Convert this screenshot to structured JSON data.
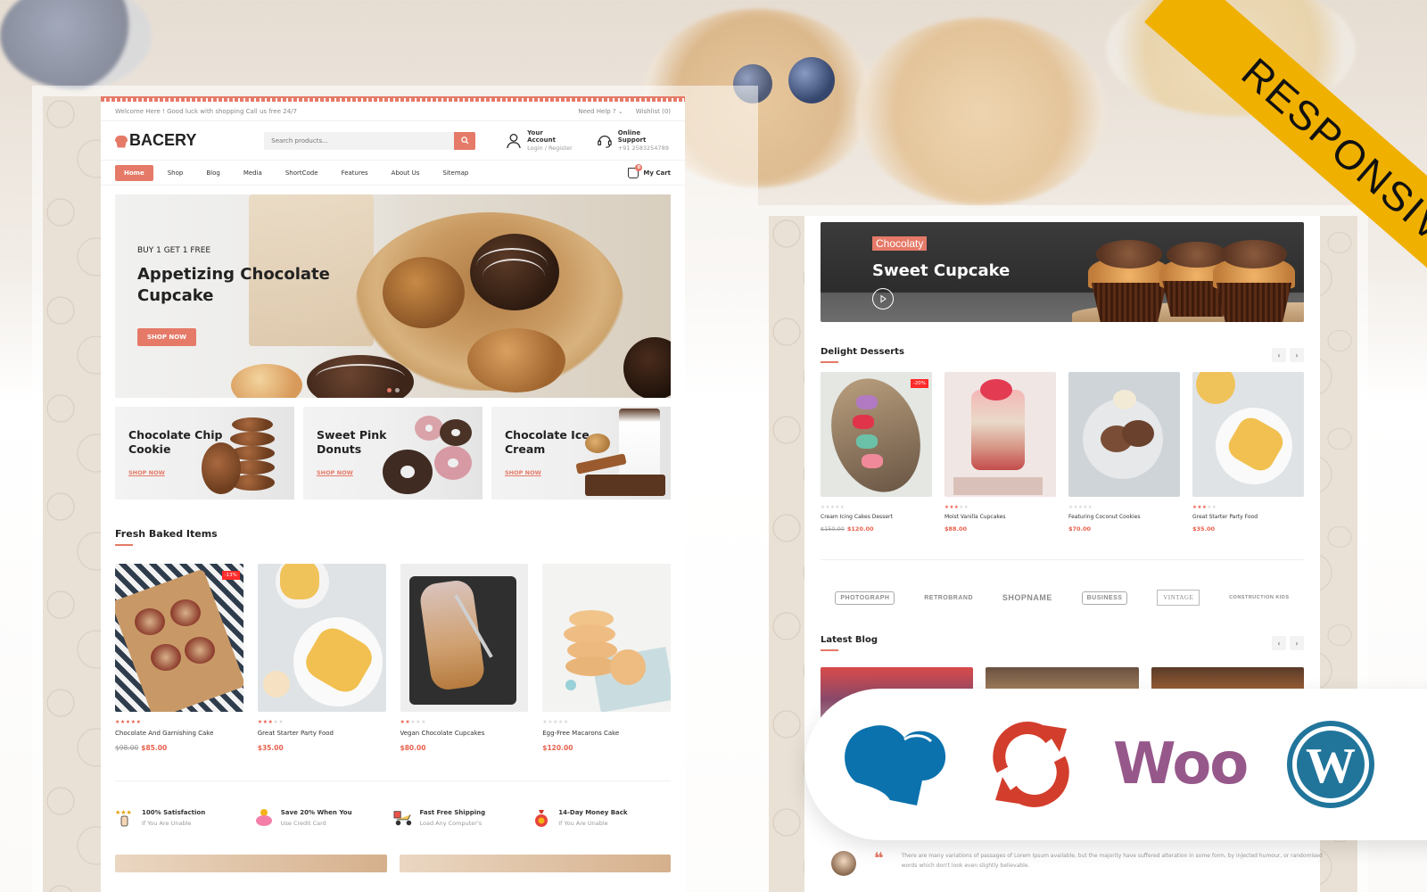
{
  "ribbon": {
    "label": "RESPONSIVE",
    "color": "#f0b000"
  },
  "colors": {
    "accent": "#e57a68",
    "sale": "#ff2a2a",
    "woo": "#96588a",
    "wordpress": "#21759b",
    "chef": "#0b72ad",
    "sync": "#d33e2c"
  },
  "desktop": {
    "topbar": {
      "welcome": "Welcome Here ! Good luck with shopping Call us free 24/7",
      "help": "Need Help ? ⌄",
      "wishlist": "Wishlist (0)"
    },
    "header": {
      "logo": "BACERY",
      "search_placeholder": "Search products...",
      "account_title": "Your Account",
      "account_sub": "Login / Register",
      "support_title": "Online Support",
      "support_sub": "+91 2583254789"
    },
    "nav": {
      "items": [
        "Home",
        "Shop",
        "Blog",
        "Media",
        "ShortCode",
        "Features",
        "About Us",
        "Sitemap"
      ],
      "active": "Home",
      "cart_label": "My Cart",
      "cart_count": "0"
    },
    "hero": {
      "subtitle": "BUY 1 GET 1 FREE",
      "title": "Appetizing Chocolate Cupcake",
      "button": "SHOP NOW"
    },
    "categories": [
      {
        "title": "Chocolate Chip Cookie",
        "link": "SHOP NOW"
      },
      {
        "title": "Sweet Pink Donuts",
        "link": "SHOP NOW"
      },
      {
        "title": "Chocolate Ice Cream",
        "link": "SHOP NOW"
      }
    ],
    "section_title": "Fresh Baked Items",
    "products": [
      {
        "name": "Chocolate And Garnishing Cake",
        "rating": 5,
        "old_price": "$98.00",
        "price": "$85.00",
        "badge": "-13%"
      },
      {
        "name": "Great Starter Party Food",
        "rating": 3,
        "old_price": "",
        "price": "$35.00",
        "badge": ""
      },
      {
        "name": "Vegan Chocolate Cupcakes",
        "rating": 2,
        "old_price": "",
        "price": "$80.00",
        "badge": ""
      },
      {
        "name": "Egg-Free Macarons Cake",
        "rating": 0,
        "old_price": "",
        "price": "$120.00",
        "badge": ""
      }
    ],
    "features": [
      {
        "icon": "satisfaction-icon",
        "title": "100% Satisfaction",
        "sub": "If You Are Unable"
      },
      {
        "icon": "piggy-bank-icon",
        "title": "Save 20% When You",
        "sub": "Use Credit Card"
      },
      {
        "icon": "delivery-scooter-icon",
        "title": "Fast Free Shipping",
        "sub": "Load Any Computer's"
      },
      {
        "icon": "money-bag-icon",
        "title": "14-Day Money Back",
        "sub": "If You Are Unable"
      }
    ]
  },
  "tablet": {
    "promo": {
      "tag": "Chocolaty",
      "title": "Sweet Cupcake"
    },
    "section_title": "Delight Desserts",
    "products": [
      {
        "name": "Cream Icing Cakes Dessert",
        "rating": 0,
        "old_price": "$150.00",
        "price": "$120.00",
        "badge": "-20%"
      },
      {
        "name": "Moist Vanilla Cupcakes",
        "rating": 3,
        "old_price": "",
        "price": "$88.00",
        "badge": ""
      },
      {
        "name": "Featuring Coconut Cookies",
        "rating": 0,
        "old_price": "",
        "price": "$70.00",
        "badge": ""
      },
      {
        "name": "Great Starter Party Food",
        "rating": 3,
        "old_price": "",
        "price": "$35.00",
        "badge": ""
      }
    ],
    "brands": [
      "PHOTOGRAPH",
      "RETROBRAND",
      "SHOPNAME",
      "BUSINESS",
      "VINTAGE",
      "CONSTRUCTION KIDS"
    ],
    "blog_title": "Latest Blog",
    "testimonial": "There are many variations of passages of Lorem Ipsum available, but the majority have suffered alteration in some form, by injected humour, or randomised words which don't look even slightly believable."
  },
  "platforms": [
    {
      "name": "chef-hat-icon"
    },
    {
      "name": "sync-icon"
    },
    {
      "name": "woocommerce-icon",
      "label": "Woo"
    },
    {
      "name": "wordpress-icon",
      "label": "W"
    }
  ]
}
